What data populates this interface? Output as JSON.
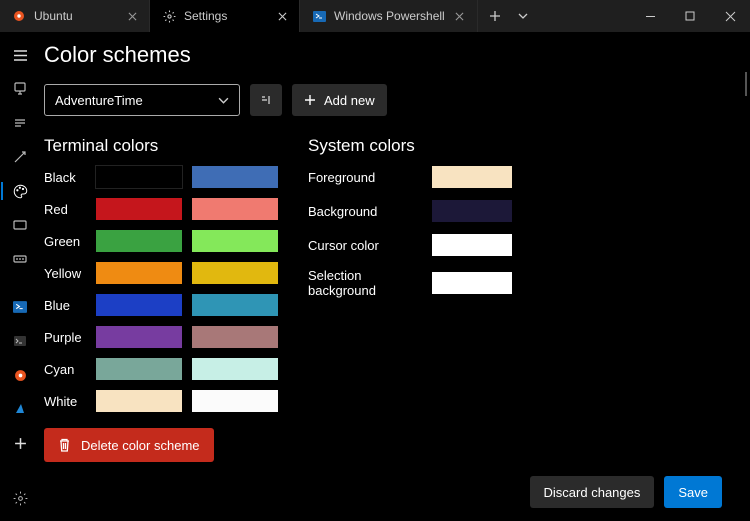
{
  "tabs": [
    {
      "label": "Ubuntu",
      "icon": "ubuntu-icon"
    },
    {
      "label": "Settings",
      "icon": "gear-icon"
    },
    {
      "label": "Windows Powershell",
      "icon": "powershell-icon"
    }
  ],
  "active_tab_index": 1,
  "sidebar": {
    "items": [
      {
        "name": "hamburger-icon"
      },
      {
        "name": "startup-icon"
      },
      {
        "name": "interaction-icon"
      },
      {
        "name": "appearance-icon"
      },
      {
        "name": "color-schemes-icon"
      },
      {
        "name": "rendering-icon"
      },
      {
        "name": "actions-icon"
      },
      {
        "name": "powershell-profile-icon"
      },
      {
        "name": "cmd-profile-icon"
      },
      {
        "name": "ubuntu-profile-icon"
      },
      {
        "name": "azure-profile-icon"
      },
      {
        "name": "add-profile-icon"
      }
    ],
    "active_index": 4
  },
  "page": {
    "title": "Color schemes",
    "selected_scheme": "AdventureTime",
    "add_new_label": "Add new",
    "delete_label": "Delete color scheme"
  },
  "sections": {
    "terminal_heading": "Terminal colors",
    "system_heading": "System colors"
  },
  "terminal_colors": [
    {
      "name": "Black",
      "normal": "#000000",
      "bright": "#3f6db5"
    },
    {
      "name": "Red",
      "normal": "#c5161c",
      "bright": "#f07a70"
    },
    {
      "name": "Green",
      "normal": "#3aa241",
      "bright": "#84e85a"
    },
    {
      "name": "Yellow",
      "normal": "#ef8b12",
      "bright": "#e1b80f"
    },
    {
      "name": "Blue",
      "normal": "#1c3fc5",
      "bright": "#2f95b5"
    },
    {
      "name": "Purple",
      "normal": "#773ca0",
      "bright": "#a87878"
    },
    {
      "name": "Cyan",
      "normal": "#79a79a",
      "bright": "#c7efe6"
    },
    {
      "name": "White",
      "normal": "#f8e3c1",
      "bright": "#fbfbfb"
    }
  ],
  "system_colors": [
    {
      "name": "Foreground",
      "value": "#f8e3c1"
    },
    {
      "name": "Background",
      "value": "#1c1838"
    },
    {
      "name": "Cursor color",
      "value": "#ffffff"
    },
    {
      "name": "Selection background",
      "value": "#ffffff"
    }
  ],
  "footer": {
    "discard_label": "Discard changes",
    "save_label": "Save"
  },
  "colors": {
    "accent": "#0078d4",
    "danger": "#c42b1c"
  }
}
